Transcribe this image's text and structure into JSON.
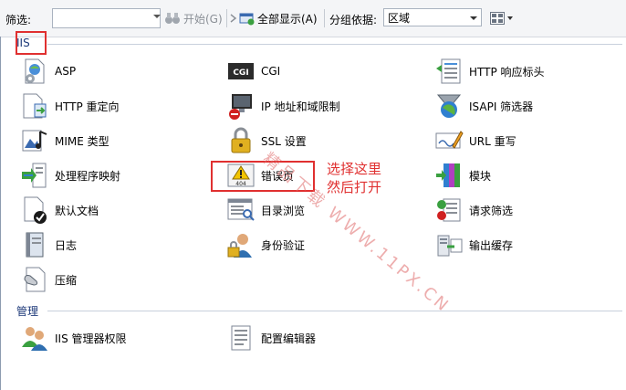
{
  "toolbar": {
    "filter_label": "筛选:",
    "filter_value": "",
    "start_label": "开始(G)",
    "show_all_label": "全部显示(A)",
    "group_by_label": "分组依据:",
    "group_by_value": "区域"
  },
  "sections": {
    "iis": {
      "label": "IIS"
    },
    "management": {
      "label": "管理"
    }
  },
  "items": {
    "asp": "ASP",
    "cgi": "CGI",
    "http_headers": "HTTP 响应标头",
    "http_redirect": "HTTP 重定向",
    "ip_restrict": "IP 地址和域限制",
    "isapi_filters": "ISAPI 筛选器",
    "mime": "MIME 类型",
    "ssl": "SSL 设置",
    "url_rewrite": "URL 重写",
    "handlers": "处理程序映射",
    "error_pages": "错误页",
    "modules": "模块",
    "default_doc": "默认文档",
    "dir_browse": "目录浏览",
    "request_filter": "请求筛选",
    "logging": "日志",
    "auth": "身份验证",
    "output_cache": "输出缓存",
    "compression": "压缩",
    "iis_manager_perms": "IIS 管理器权限",
    "config_editor": "配置编辑器"
  },
  "annotation": {
    "line1": "选择这里",
    "line2": "然后打开"
  },
  "watermark": "精品下载 WWW.11PX.CN",
  "colors": {
    "highlight": "#e03030",
    "section_text": "#1e3a7a"
  },
  "icons": {
    "asp": "asp-page-gear-icon",
    "cgi": "cgi-console-icon",
    "http_headers": "header-list-icon",
    "http_redirect": "redirect-page-icon",
    "ip_restrict": "ip-monitor-icon",
    "isapi_filters": "isapi-globe-icon",
    "mime": "mime-type-icon",
    "ssl": "padlock-icon",
    "url_rewrite": "url-rewrite-icon",
    "handlers": "handler-mapping-icon",
    "error_pages": "warning-404-icon",
    "modules": "modules-icon",
    "default_doc": "default-document-icon",
    "dir_browse": "directory-browsing-icon",
    "request_filter": "request-filter-icon",
    "logging": "log-book-icon",
    "auth": "user-lock-icon",
    "output_cache": "output-cache-icon",
    "compression": "compression-icon",
    "iis_manager_perms": "users-icon",
    "config_editor": "config-editor-icon"
  }
}
